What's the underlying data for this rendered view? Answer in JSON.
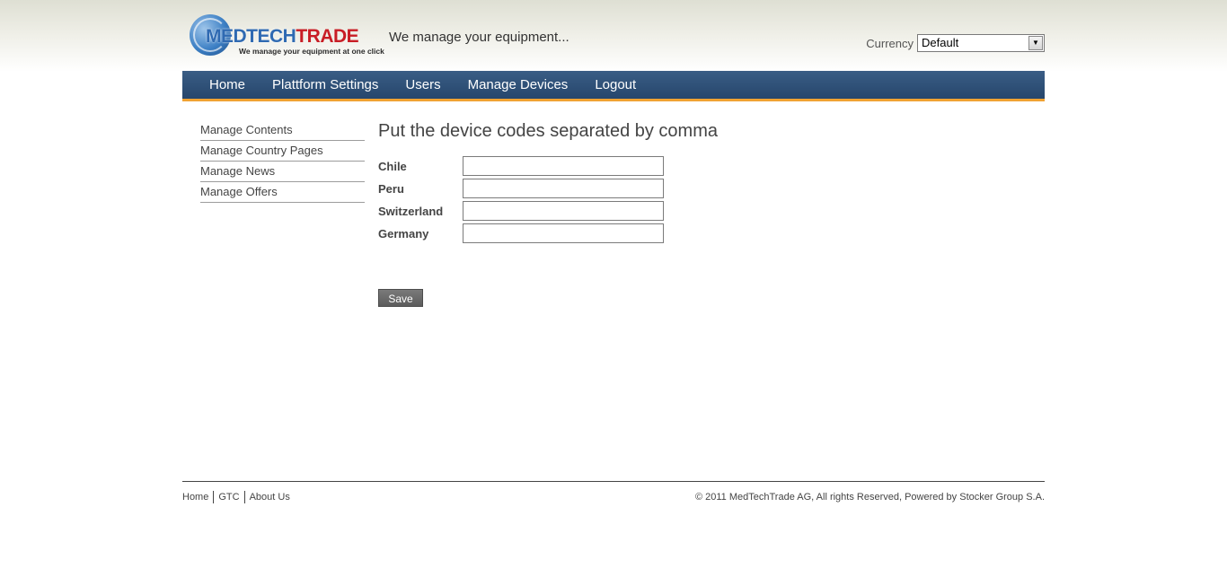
{
  "header": {
    "logo": {
      "brand_prefix": "MEDTECH",
      "brand_suffix": "TRADE",
      "tagline_small": "We manage your equipment at one click"
    },
    "tagline": "We manage your equipment...",
    "currency": {
      "label": "Currency",
      "selected": "Default"
    }
  },
  "nav": {
    "items": [
      {
        "label": "Home"
      },
      {
        "label": "Plattform Settings"
      },
      {
        "label": "Users"
      },
      {
        "label": "Manage Devices"
      },
      {
        "label": "Logout"
      }
    ]
  },
  "sidebar": {
    "items": [
      {
        "label": "Manage Contents"
      },
      {
        "label": "Manage Country Pages"
      },
      {
        "label": "Manage News"
      },
      {
        "label": "Manage Offers"
      }
    ]
  },
  "main": {
    "title": "Put the device codes separated by comma",
    "fields": [
      {
        "label": "Chile",
        "value": ""
      },
      {
        "label": "Peru",
        "value": ""
      },
      {
        "label": "Switzerland",
        "value": ""
      },
      {
        "label": "Germany",
        "value": ""
      }
    ],
    "save_label": "Save"
  },
  "footer": {
    "links": [
      {
        "label": "Home"
      },
      {
        "label": "GTC"
      },
      {
        "label": "About Us"
      }
    ],
    "copyright": "© 2011 MedTechTrade AG, All rights Reserved, Powered by Stocker Group S.A."
  },
  "colors": {
    "nav_background": "#2b4b72",
    "nav_accent": "#f0a233",
    "brand_blue": "#2f6ab2",
    "brand_red": "#c81d25",
    "button_gray": "#6b6b6b"
  }
}
